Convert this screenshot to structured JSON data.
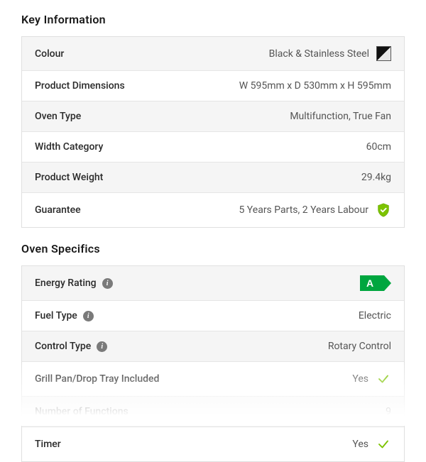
{
  "sections": [
    {
      "title": "Key Information",
      "rows": [
        {
          "label": "Colour",
          "value": "Black & Stainless Steel",
          "valueIcon": "swatch"
        },
        {
          "label": "Product Dimensions",
          "value": "W 595mm x D 530mm x H 595mm"
        },
        {
          "label": "Oven Type",
          "value": "Multifunction, True Fan"
        },
        {
          "label": "Width Category",
          "value": "60cm"
        },
        {
          "label": "Product Weight",
          "value": "29.4kg"
        },
        {
          "label": "Guarantee",
          "value": "5 Years Parts, 2 Years Labour",
          "valueIcon": "shield"
        }
      ]
    },
    {
      "title": "Oven Specifics",
      "rows": [
        {
          "label": "Energy Rating",
          "labelIcon": "info",
          "value": "",
          "valueIcon": "energy",
          "energyGrade": "A"
        },
        {
          "label": "Fuel Type",
          "labelIcon": "info",
          "value": "Electric"
        },
        {
          "label": "Control Type",
          "labelIcon": "info",
          "value": "Rotary Control"
        },
        {
          "label": "Grill Pan/Drop Tray Included",
          "value": "Yes",
          "valueIcon": "check"
        },
        {
          "label": "Number of Functions",
          "value": "9"
        },
        {
          "label": "Timer",
          "value": "Yes",
          "valueIcon": "check"
        }
      ]
    }
  ]
}
